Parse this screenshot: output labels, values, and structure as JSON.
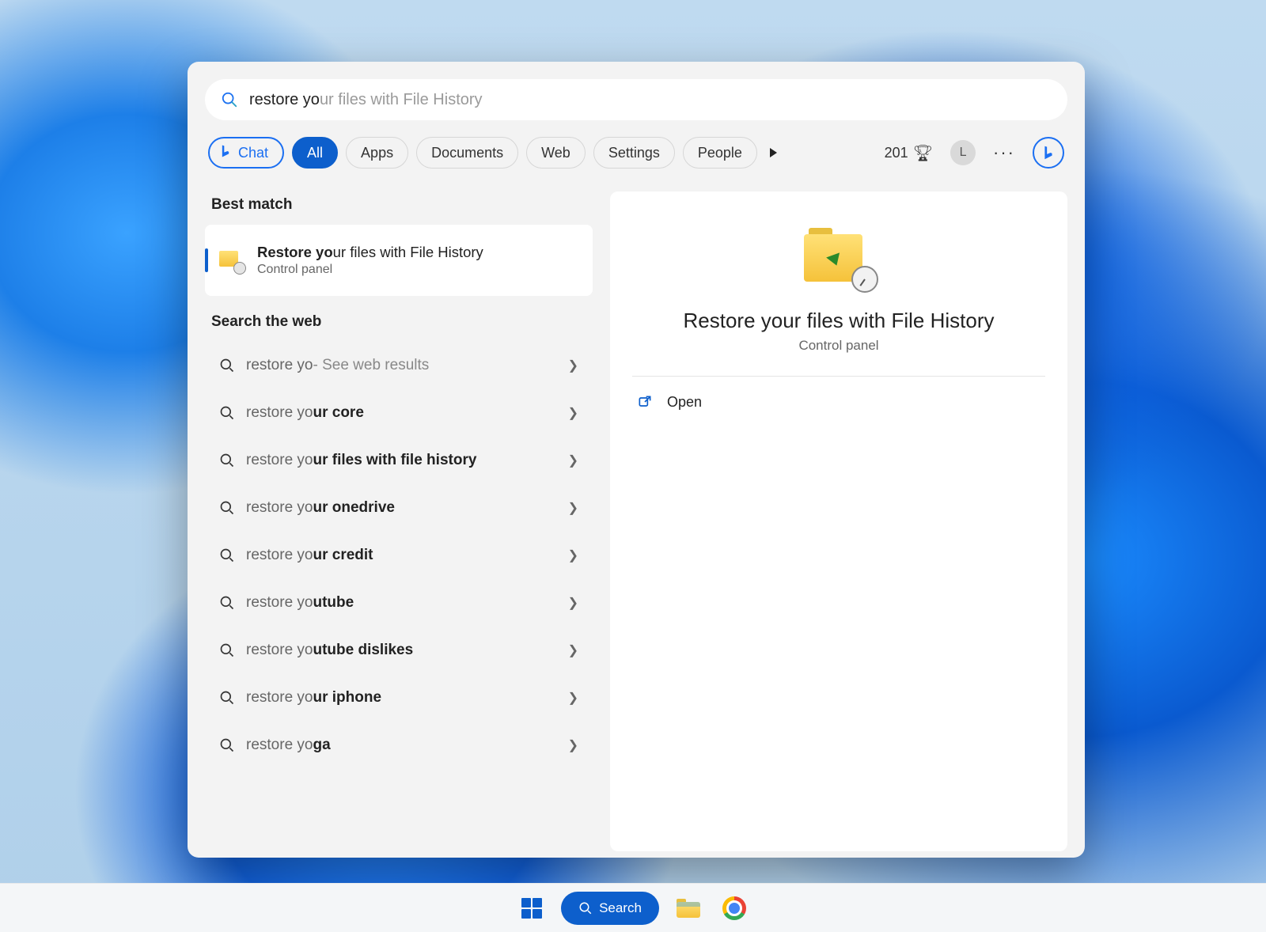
{
  "search": {
    "typed": "restore yo",
    "suggest": "ur files with File History"
  },
  "filters": {
    "chat": "Chat",
    "all": "All",
    "apps": "Apps",
    "documents": "Documents",
    "web": "Web",
    "settings": "Settings",
    "people": "People"
  },
  "header": {
    "rewards": "201",
    "avatar": "L"
  },
  "sections": {
    "best_match": "Best match",
    "search_web": "Search the web"
  },
  "best_match": {
    "title_pre": "Restore yo",
    "title_post": "ur files with File History",
    "subtitle": "Control panel"
  },
  "web_results": [
    {
      "pre": "restore yo",
      "bold": "",
      "post": "",
      "hint": " - See web results"
    },
    {
      "pre": "restore yo",
      "bold": "ur core",
      "post": "",
      "hint": ""
    },
    {
      "pre": "restore yo",
      "bold": "ur files with file history",
      "post": "",
      "hint": ""
    },
    {
      "pre": "restore yo",
      "bold": "ur onedrive",
      "post": "",
      "hint": ""
    },
    {
      "pre": "restore yo",
      "bold": "ur credit",
      "post": "",
      "hint": ""
    },
    {
      "pre": "restore yo",
      "bold": "utube",
      "post": "",
      "hint": ""
    },
    {
      "pre": "restore yo",
      "bold": "utube dislikes",
      "post": "",
      "hint": ""
    },
    {
      "pre": "restore yo",
      "bold": "ur iphone",
      "post": "",
      "hint": ""
    },
    {
      "pre": "restore yo",
      "bold": "ga",
      "post": "",
      "hint": ""
    }
  ],
  "detail": {
    "title": "Restore your files with File History",
    "subtitle": "Control panel",
    "open": "Open"
  },
  "taskbar": {
    "search": "Search"
  }
}
